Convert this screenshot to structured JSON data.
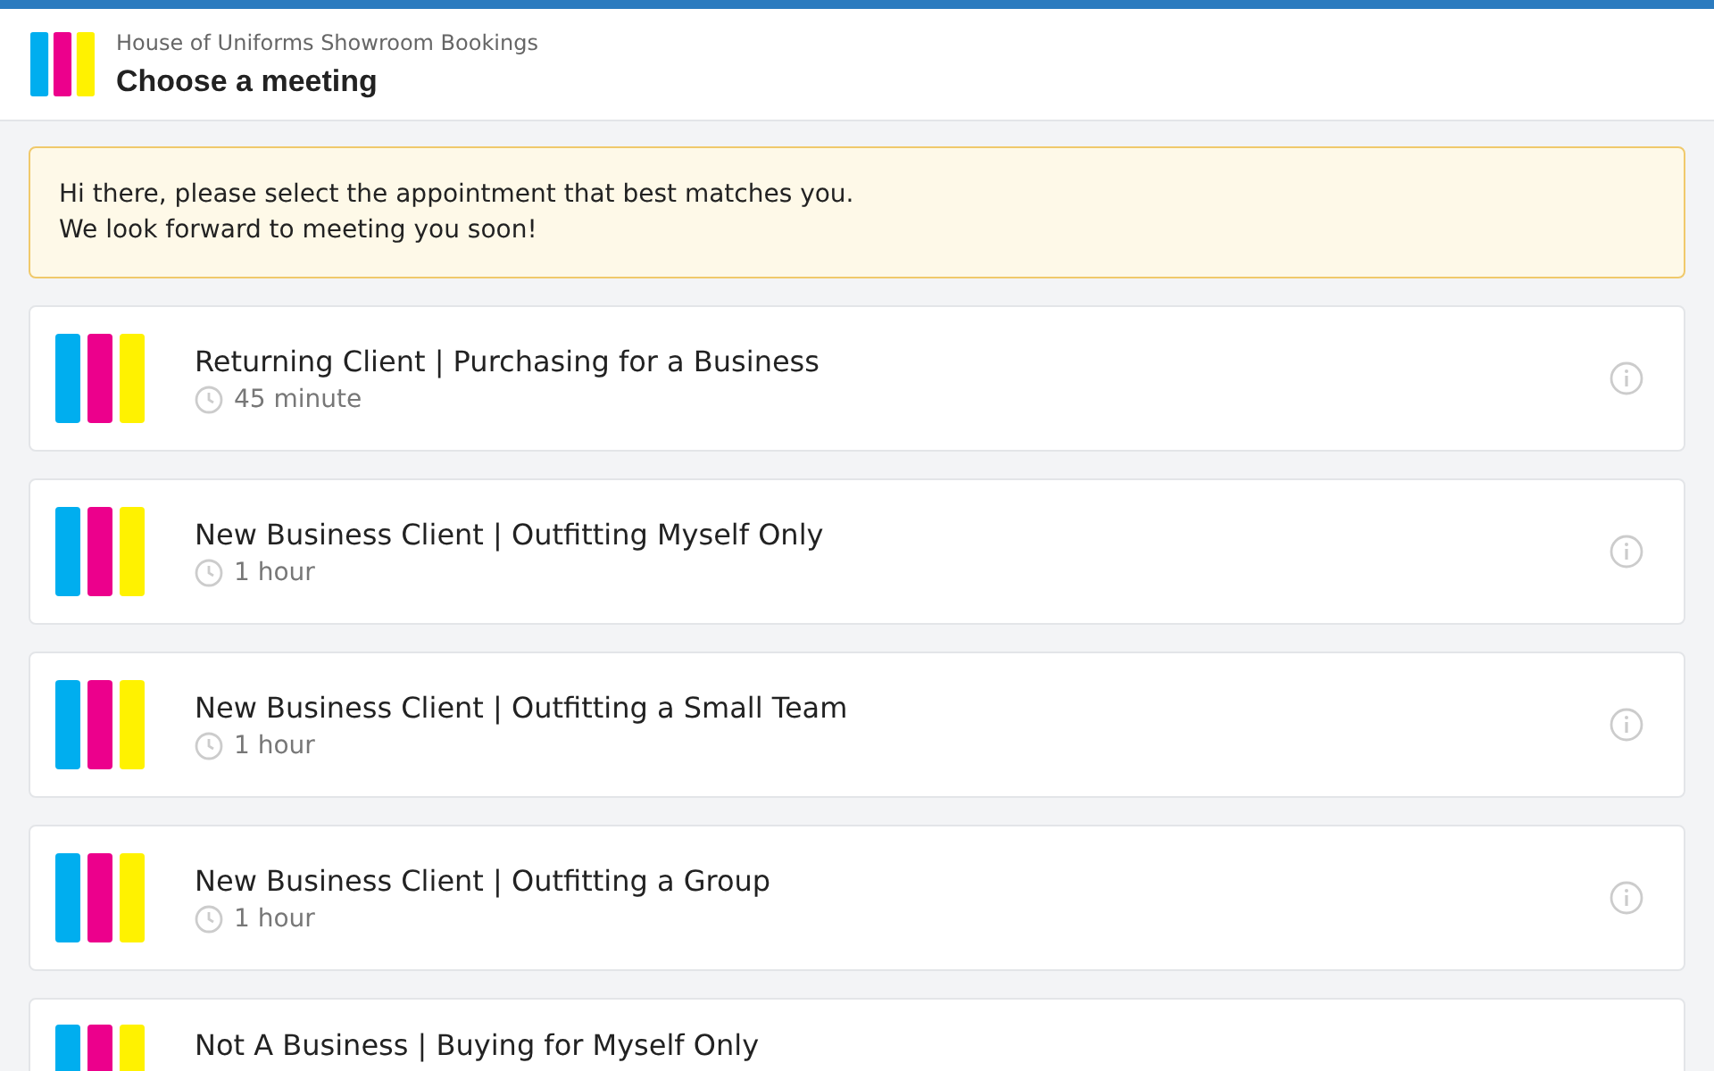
{
  "header": {
    "subtitle": "House of Uniforms Showroom Bookings",
    "title": "Choose a meeting"
  },
  "notice": {
    "lines": [
      "Hi there, please select the appointment that best matches you.",
      "We look forward to meeting you soon!"
    ]
  },
  "meetings": [
    {
      "title": "Returning Client | Purchasing for a Business",
      "duration": "45 minute"
    },
    {
      "title": "New Business Client | Outfitting Myself Only",
      "duration": "1 hour"
    },
    {
      "title": "New Business Client | Outfitting a Small Team",
      "duration": "1 hour"
    },
    {
      "title": "New Business Client | Outfitting a Group",
      "duration": "1 hour"
    },
    {
      "title": "Not A Business | Buying for Myself Only"
    }
  ]
}
